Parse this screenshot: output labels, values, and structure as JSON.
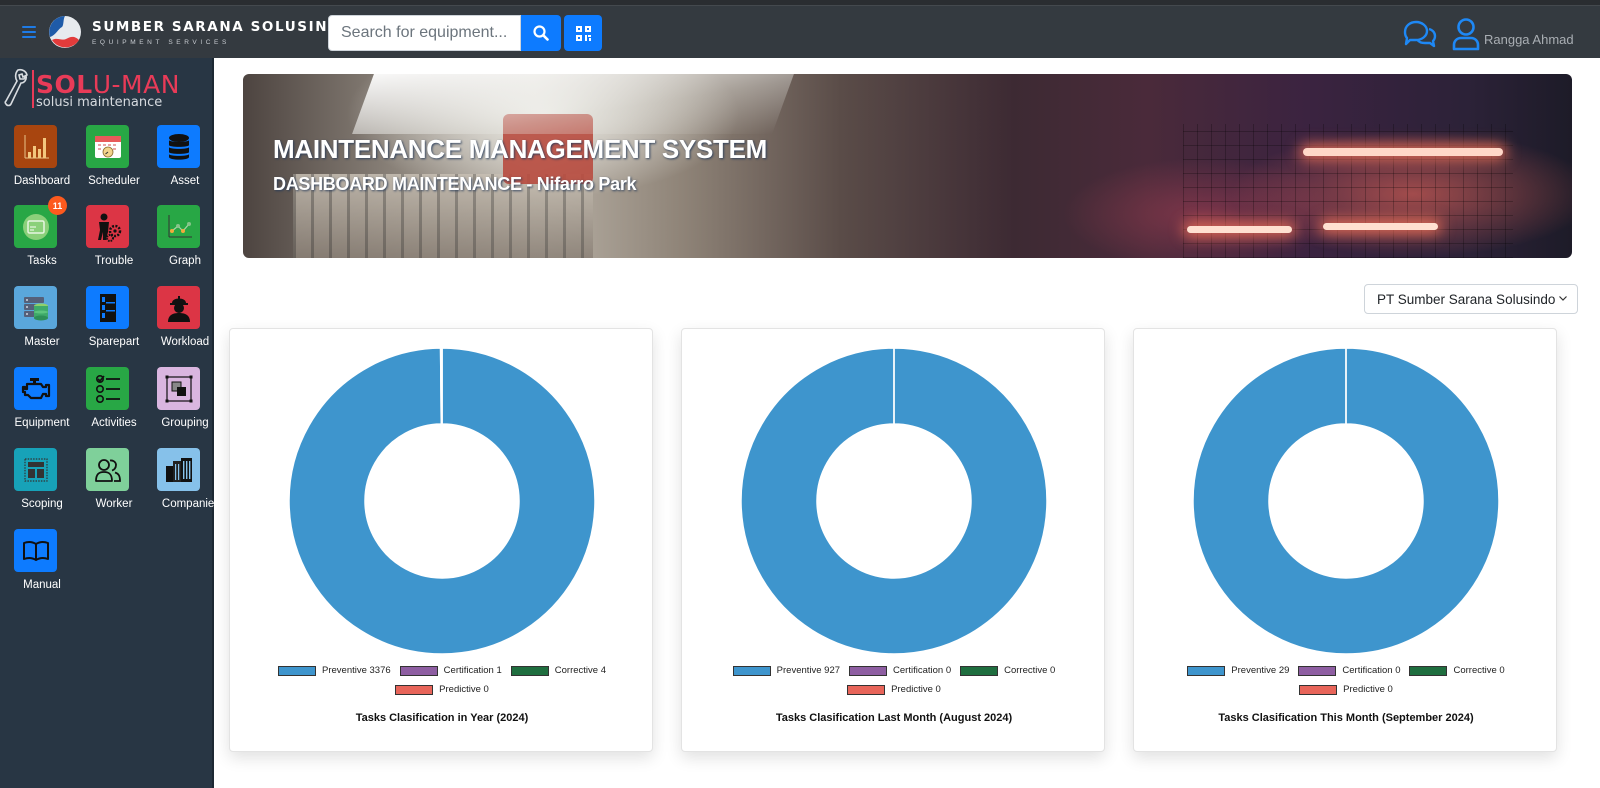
{
  "header": {
    "brand_name": "SUMBER SARANA SOLUSINDO",
    "brand_sub": "EQUIPMENT SERVICES",
    "search_placeholder": "Search for equipment...",
    "user_name": "Rangga Ahmad",
    "icons": {
      "menu": "hamburger-icon",
      "search": "search-icon",
      "qr": "qrcode-icon",
      "chat": "chat-icon",
      "user": "user-icon"
    }
  },
  "sidebar": {
    "logo_title_bold": "SOL",
    "logo_title_rest": "U-MAN",
    "logo_sub": "solusi maintenance",
    "items": [
      {
        "label": "Dashboard",
        "icon": "bar-chart-icon",
        "color": "#a8450f"
      },
      {
        "label": "Scheduler",
        "icon": "calendar-icon",
        "color": "#28a745"
      },
      {
        "label": "Asset",
        "icon": "database-icon",
        "color": "#0d7bff"
      },
      {
        "label": "Tasks",
        "icon": "card-icon",
        "color": "#28a745",
        "badge": "11"
      },
      {
        "label": "Trouble",
        "icon": "worker-gear-icon",
        "color": "#dc3545"
      },
      {
        "label": "Graph",
        "icon": "line-graph-icon",
        "color": "#28a745"
      },
      {
        "label": "Master",
        "icon": "server-db-icon",
        "color": "#5aa7dc"
      },
      {
        "label": "Sparepart",
        "icon": "cabinet-icon",
        "color": "#0d7bff"
      },
      {
        "label": "Workload",
        "icon": "worker-helmet-icon",
        "color": "#dc3545"
      },
      {
        "label": "Equipment",
        "icon": "engine-icon",
        "color": "#0d7bff"
      },
      {
        "label": "Activities",
        "icon": "checklist-icon",
        "color": "#28a745"
      },
      {
        "label": "Grouping",
        "icon": "group-objects-icon",
        "color": "#dab6e0"
      },
      {
        "label": "Scoping",
        "icon": "layout-icon",
        "color": "#17a2b8"
      },
      {
        "label": "Worker",
        "icon": "users-icon",
        "color": "#7fd09a"
      },
      {
        "label": "Companies",
        "icon": "buildings-icon",
        "color": "#86c1ea"
      },
      {
        "label": "Manual",
        "icon": "book-icon",
        "color": "#0d7bff"
      }
    ]
  },
  "hero": {
    "title": "MAINTENANCE MANAGEMENT SYSTEM",
    "subtitle": "DASHBOARD MAINTENANCE - Nifarro Park"
  },
  "company_select": {
    "selected": "PT Sumber Sarana Solusindo"
  },
  "chart_data": [
    {
      "type": "pie",
      "donut": true,
      "title": "Tasks Clasification in Year (2024)",
      "categories": [
        "Preventive",
        "Certification",
        "Corrective",
        "Predictive"
      ],
      "values": [
        3376,
        1,
        4,
        0
      ],
      "colors": [
        "#3e95cd",
        "#8e5ea2",
        "#1f6e3f",
        "#e8655a"
      ],
      "legend": [
        "Preventive 3376",
        "Certification 1",
        "Corrective 4",
        "Predictive 0"
      ],
      "legend_position": "bottom"
    },
    {
      "type": "pie",
      "donut": true,
      "title": "Tasks Clasification Last Month (August 2024)",
      "categories": [
        "Preventive",
        "Certification",
        "Corrective",
        "Predictive"
      ],
      "values": [
        927,
        0,
        0,
        0
      ],
      "colors": [
        "#3e95cd",
        "#8e5ea2",
        "#1f6e3f",
        "#e8655a"
      ],
      "legend": [
        "Preventive 927",
        "Certification 0",
        "Corrective 0",
        "Predictive 0"
      ],
      "legend_position": "bottom"
    },
    {
      "type": "pie",
      "donut": true,
      "title": "Tasks Clasification This Month (September 2024)",
      "categories": [
        "Preventive",
        "Certification",
        "Corrective",
        "Predictive"
      ],
      "values": [
        29,
        0,
        0,
        0
      ],
      "colors": [
        "#3e95cd",
        "#8e5ea2",
        "#1f6e3f",
        "#e8655a"
      ],
      "legend": [
        "Preventive 29",
        "Certification 0",
        "Corrective 0",
        "Predictive 0"
      ],
      "legend_position": "bottom"
    }
  ]
}
